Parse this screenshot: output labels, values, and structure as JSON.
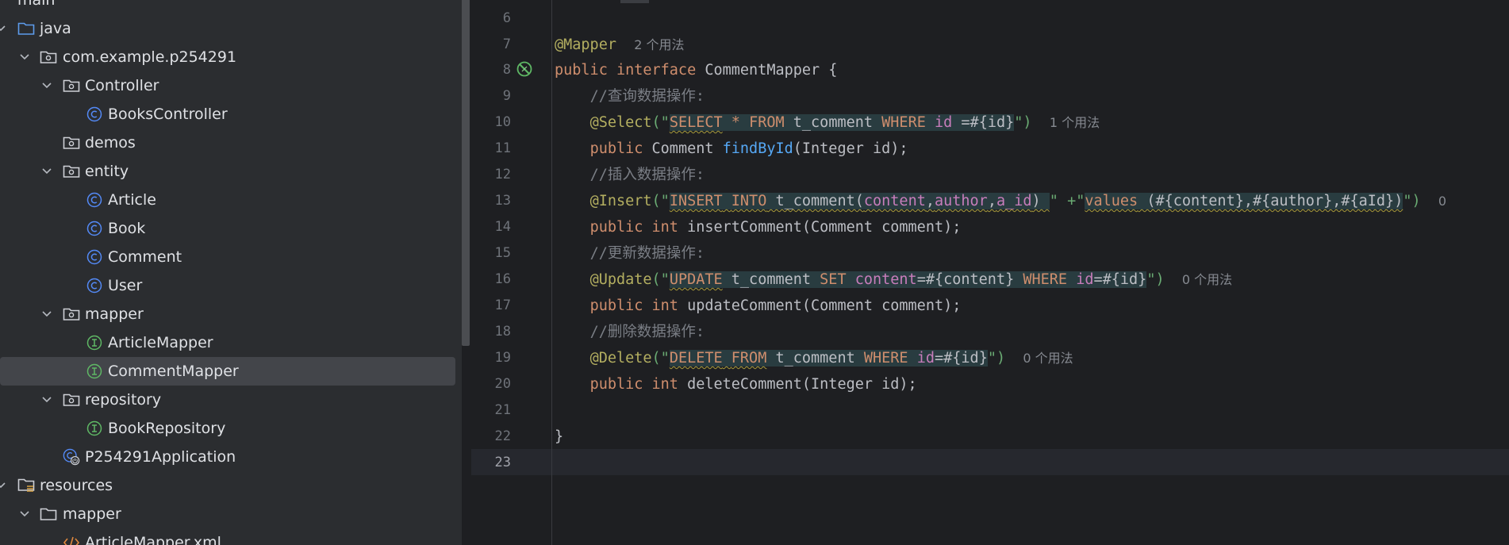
{
  "project_tree": {
    "items": [
      {
        "label": "main",
        "kind": "folder"
      },
      {
        "label": "java",
        "kind": "source-folder"
      },
      {
        "label": "com.example.p254291",
        "kind": "package"
      },
      {
        "label": "Controller",
        "kind": "package"
      },
      {
        "label": "BooksController",
        "kind": "class"
      },
      {
        "label": "demos",
        "kind": "package"
      },
      {
        "label": "entity",
        "kind": "package"
      },
      {
        "label": "Article",
        "kind": "class"
      },
      {
        "label": "Book",
        "kind": "class"
      },
      {
        "label": "Comment",
        "kind": "class"
      },
      {
        "label": "User",
        "kind": "class"
      },
      {
        "label": "mapper",
        "kind": "package"
      },
      {
        "label": "ArticleMapper",
        "kind": "interface"
      },
      {
        "label": "CommentMapper",
        "kind": "interface",
        "selected": true
      },
      {
        "label": "repository",
        "kind": "package"
      },
      {
        "label": "BookRepository",
        "kind": "interface"
      },
      {
        "label": "P254291Application",
        "kind": "spring-boot-class"
      },
      {
        "label": "resources",
        "kind": "resources-folder"
      },
      {
        "label": "mapper",
        "kind": "folder"
      },
      {
        "label": "ArticleMapper.xml",
        "kind": "xml-file"
      }
    ]
  },
  "editor": {
    "line_numbers": [
      "6",
      "7",
      "8",
      "9",
      "10",
      "11",
      "12",
      "13",
      "14",
      "15",
      "16",
      "17",
      "18",
      "19",
      "20",
      "21",
      "22",
      "23"
    ],
    "current_line": "23",
    "usage_hints": {
      "mapper": "2 个用法",
      "select": "1 个用法",
      "update": "0 个用法",
      "delete": "0 个用法",
      "insert_truncated": "0"
    },
    "code": {
      "l7_annotation": "@Mapper",
      "l8_public": "public",
      "l8_interface": "interface",
      "l8_name": "CommentMapper {",
      "l9_comment": "//查询数据操作:",
      "l10_ann": "@Select",
      "l10_open": "(\"",
      "l10_s1": "SELECT",
      "l10_s2": " * ",
      "l10_s3": "FROM",
      "l10_s4": " t_comment ",
      "l10_s5": "WHERE",
      "l10_s6": " ",
      "l10_s7": "id",
      "l10_s8": " =#{id}",
      "l10_close": "\")",
      "l11_public": "public",
      "l11_type": " Comment ",
      "l11_fn": "findById",
      "l11_args": "(Integer id);",
      "l12_comment": "//插入数据操作:",
      "l13_ann": "@Insert",
      "l13_open": "(\"",
      "l13_s1": "INSERT",
      "l13_s2": " ",
      "l13_s3": "INTO",
      "l13_s4": " t_comment(",
      "l13_s5": "content",
      "l13_s6": ",",
      "l13_s7": "author",
      "l13_s8": ",",
      "l13_s9": "a_id",
      "l13_s10": ") ",
      "l13_mid": "\" +\"",
      "l13_s11": "values",
      "l13_s12": " (#{content},#{author},#{aId})",
      "l13_close": "\")",
      "l14_public": "public",
      "l14_int": " int ",
      "l14_fn": "insertComment",
      "l14_args": "(Comment comment);",
      "l15_comment": "//更新数据操作:",
      "l16_ann": "@Update",
      "l16_open": "(\"",
      "l16_s1": "UPDATE",
      "l16_s2": " t_comment ",
      "l16_s3": "SET",
      "l16_s4": " ",
      "l16_s5": "content",
      "l16_s6": "=#{content} ",
      "l16_s7": "WHERE",
      "l16_s8": " ",
      "l16_s9": "id",
      "l16_s10": "=#{id}",
      "l16_close": "\")",
      "l17_public": "public",
      "l17_int": " int ",
      "l17_fn": "updateComment",
      "l17_args": "(Comment comment);",
      "l18_comment": "//删除数据操作:",
      "l19_ann": "@Delete",
      "l19_open": "(\"",
      "l19_s1": "DELETE",
      "l19_s2": " ",
      "l19_s3": "FROM",
      "l19_s4": " t_comment ",
      "l19_s5": "WHERE",
      "l19_s6": " ",
      "l19_s7": "id",
      "l19_s8": "=#{id}",
      "l19_close": "\")",
      "l20_public": "public",
      "l20_int": " int ",
      "l20_fn": "deleteComment",
      "l20_args": "(Integer id);",
      "l22_brace": "}"
    }
  }
}
